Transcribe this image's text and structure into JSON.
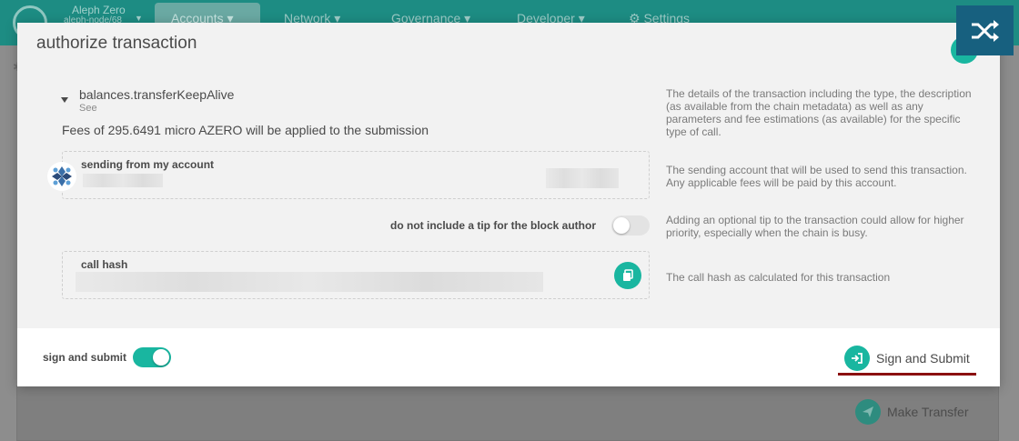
{
  "app": {
    "chain_name": "Aleph Zero",
    "chain_node": "aleph-node/68",
    "nav": [
      {
        "label": "Accounts ▾"
      },
      {
        "label": "Network ▾"
      },
      {
        "label": "Governance ▾"
      },
      {
        "label": "Developer ▾"
      },
      {
        "label": "⚙ Settings"
      }
    ],
    "make_transfer_label": "Make Transfer"
  },
  "modal": {
    "title": "authorize transaction",
    "call": {
      "name": "balances.transferKeepAlive",
      "see_label": "See",
      "fees_text": "Fees of 295.6491 micro AZERO will be applied to the submission",
      "help": "The details of the transaction including the type, the description (as available from the chain metadata) as well as any parameters and fee estimations (as available) for the specific type of call."
    },
    "sender": {
      "label": "sending from my account",
      "help": "The sending account that will be used to send this transaction. Any applicable fees will be paid by this account."
    },
    "tip": {
      "label": "do not include a tip for the block author",
      "enabled": false,
      "help": "Adding an optional tip to the transaction could allow for higher priority, especially when the chain is busy."
    },
    "call_hash": {
      "label": "call hash",
      "help": "The call hash as calculated for this transaction"
    },
    "footer": {
      "sign_label": "sign and submit",
      "sign_enabled": true,
      "submit_label": "Sign and Submit"
    }
  },
  "colors": {
    "accent": "#19b6a0",
    "header_bg": "#1d8c83",
    "shuffle_bg": "#17607f",
    "underline": "#8b1010"
  }
}
